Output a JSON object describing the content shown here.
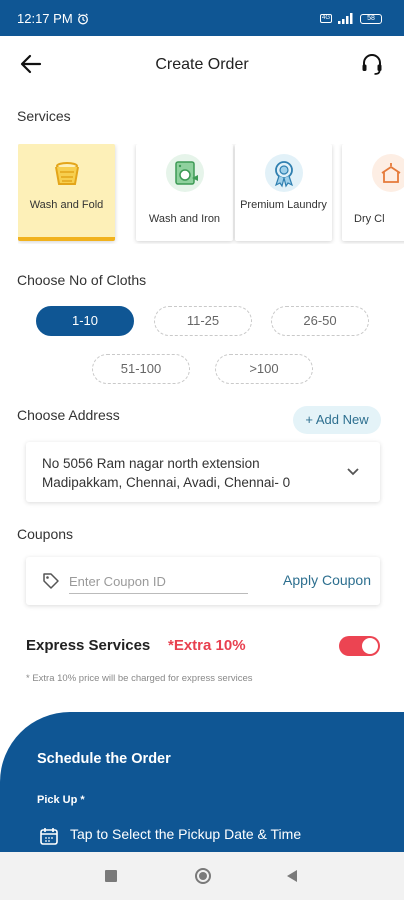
{
  "status_bar": {
    "time": "12:17 PM",
    "battery": "58"
  },
  "header": {
    "title": "Create Order"
  },
  "services": {
    "label": "Services",
    "items": [
      {
        "label": "Wash and Fold",
        "icon": "laundry-basket-icon",
        "selected": true
      },
      {
        "label": "Wash and Iron",
        "icon": "washing-machine-icon",
        "selected": false
      },
      {
        "label": "Premium Laundry",
        "icon": "premium-badge-icon",
        "selected": false
      },
      {
        "label": "Dry Cl",
        "icon": "dry-clean-icon",
        "selected": false
      }
    ]
  },
  "cloths": {
    "label": "Choose No of Cloths",
    "options": [
      "1-10",
      "11-25",
      "26-50",
      "51-100",
      ">100"
    ],
    "selected": "1-10"
  },
  "address": {
    "label": "Choose Address",
    "add_new": "+ Add New",
    "line1": "No 5056 Ram nagar north extension",
    "line2": "Madipakkam, Chennai, Avadi, Chennai- 0"
  },
  "coupons": {
    "label": "Coupons",
    "placeholder": "Enter Coupon ID",
    "apply": "Apply Coupon"
  },
  "express": {
    "label": "Express Services",
    "extra": "*Extra 10%",
    "note": "* Extra 10% price will be charged for express services",
    "enabled": true
  },
  "schedule": {
    "title": "Schedule the Order",
    "pickup_label": "Pick Up *",
    "pickup_cta": "Tap to Select the Pickup Date & Time"
  },
  "colors": {
    "primary": "#0f5694",
    "accent_red": "#ec4452",
    "selected_card": "#fdf0b8",
    "selected_bar": "#f1b21d"
  }
}
